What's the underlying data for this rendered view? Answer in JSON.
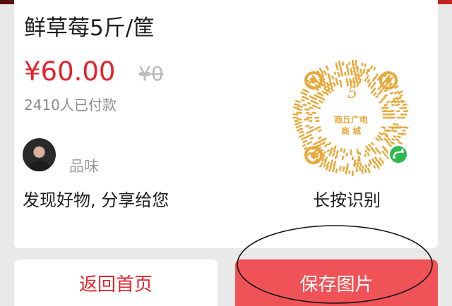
{
  "product": {
    "title": "鲜草莓5斤/筐",
    "price": "¥60.00",
    "original_price": "¥0",
    "paid_count": "2410人已付款"
  },
  "sharer": {
    "name": "品味",
    "message": "发现好物, 分享给您"
  },
  "qr": {
    "logo_line1": "商丘广电",
    "logo_line2": "商 城",
    "hint": "长按识别"
  },
  "buttons": {
    "home": "返回首页",
    "save": "保存图片"
  },
  "colors": {
    "accent": "#e4242e",
    "qr_gold": "#e8a93c",
    "wechat_green": "#2db94d",
    "save_bg": "#f05357"
  }
}
